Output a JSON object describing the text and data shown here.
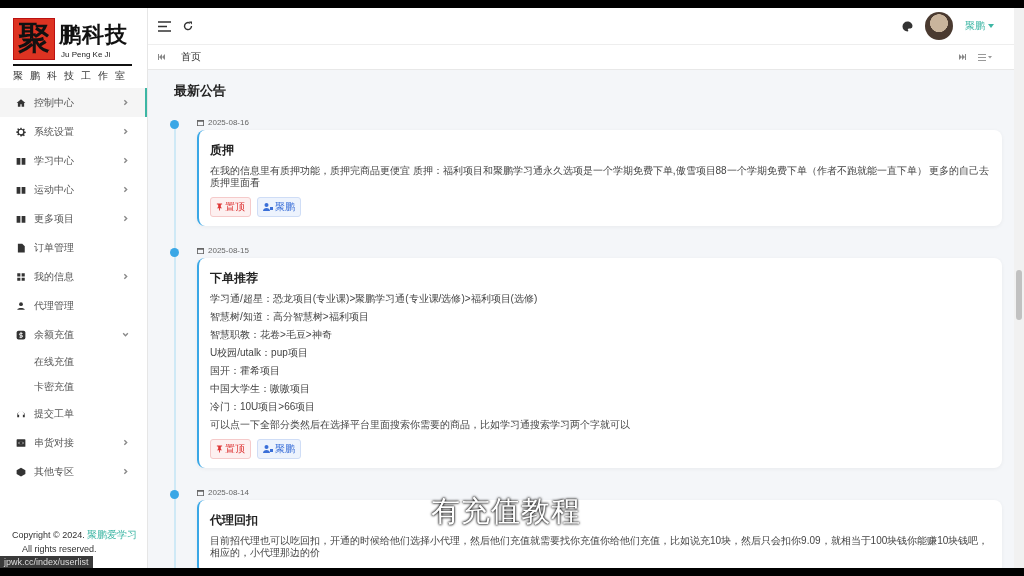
{
  "logo": {
    "mark": "聚",
    "name": "鹏科技",
    "subtitle": "Ju Peng Ke Ji",
    "tagline": "聚鹏科技工作室"
  },
  "sidebar": {
    "items": [
      {
        "label": "控制中心",
        "kind": "submenu",
        "expanded": false,
        "selected": true
      },
      {
        "label": "系统设置",
        "kind": "submenu",
        "expanded": false,
        "selected": false
      },
      {
        "label": "学习中心",
        "kind": "submenu",
        "expanded": false,
        "selected": false
      },
      {
        "label": "运动中心",
        "kind": "submenu",
        "expanded": false,
        "selected": false
      },
      {
        "label": "更多项目",
        "kind": "submenu",
        "expanded": false,
        "selected": false
      },
      {
        "label": "订单管理",
        "kind": "link",
        "selected": false
      },
      {
        "label": "我的信息",
        "kind": "submenu",
        "expanded": false,
        "selected": false
      },
      {
        "label": "代理管理",
        "kind": "link",
        "selected": false
      },
      {
        "label": "余额充值",
        "kind": "submenu",
        "expanded": true,
        "selected": false,
        "children": [
          {
            "label": "在线充值"
          },
          {
            "label": "卡密充值"
          }
        ]
      },
      {
        "label": "提交工单",
        "kind": "link",
        "selected": false
      },
      {
        "label": "串货对接",
        "kind": "submenu",
        "expanded": false,
        "selected": false
      },
      {
        "label": "其他专区",
        "kind": "submenu",
        "expanded": false,
        "selected": false
      }
    ],
    "footer": {
      "copyright": "Copyright © 2024.",
      "link": "聚鹏爱学习",
      "rights": "All rights reserved."
    }
  },
  "topbar": {
    "user": "聚鹏"
  },
  "tabs": [
    {
      "label": "首页",
      "selected": true
    }
  ],
  "notices": {
    "title": "最新公告",
    "items": [
      {
        "date": "2025-08-16",
        "title": "质押",
        "paragraphs": [
          "在我的信息里有质押功能，质押完商品更便宜 质押：福利项目和聚鹏学习通永久选项是一个学期免费下单,傲雪项目88一个学期免费下单（作者不跑就能一直下单） 更多的自己去质押里面看"
        ],
        "tags": [
          {
            "kind": "pin",
            "label": "置顶"
          },
          {
            "kind": "author",
            "label": "聚鹏"
          }
        ]
      },
      {
        "date": "2025-08-15",
        "title": "下单推荐",
        "paragraphs": [
          "学习通/超星：恐龙项目(专业课)>聚鹏学习通(专业课/选修)>福利项目(选修)",
          "智慧树/知道：高分智慧树>福利项目",
          "智慧职教：花卷>毛豆>神奇",
          "U校园/utalk：pup项目",
          "国开：霍希项目",
          "中国大学生：嗷嗷项目",
          "冷门：10U项目>66项目",
          "可以点一下全部分类然后在选择平台里面搜索你需要的商品，比如学习通搜索学习两个字就可以"
        ],
        "tags": [
          {
            "kind": "pin",
            "label": "置顶"
          },
          {
            "kind": "author",
            "label": "聚鹏"
          }
        ]
      },
      {
        "date": "2025-08-14",
        "title": "代理回扣",
        "paragraphs": [
          "目前招代理也可以吃回扣，开通的时候给他们选择小代理，然后他们充值就需要找你充值你给他们充值，比如说充10块，然后只会扣你9.09，就相当于100块钱你能赚10块钱吧，相应的，小代理那边的价"
        ]
      }
    ]
  },
  "status_url": "jpwk.cc/index/userlist",
  "subtitle": "有充值教程"
}
